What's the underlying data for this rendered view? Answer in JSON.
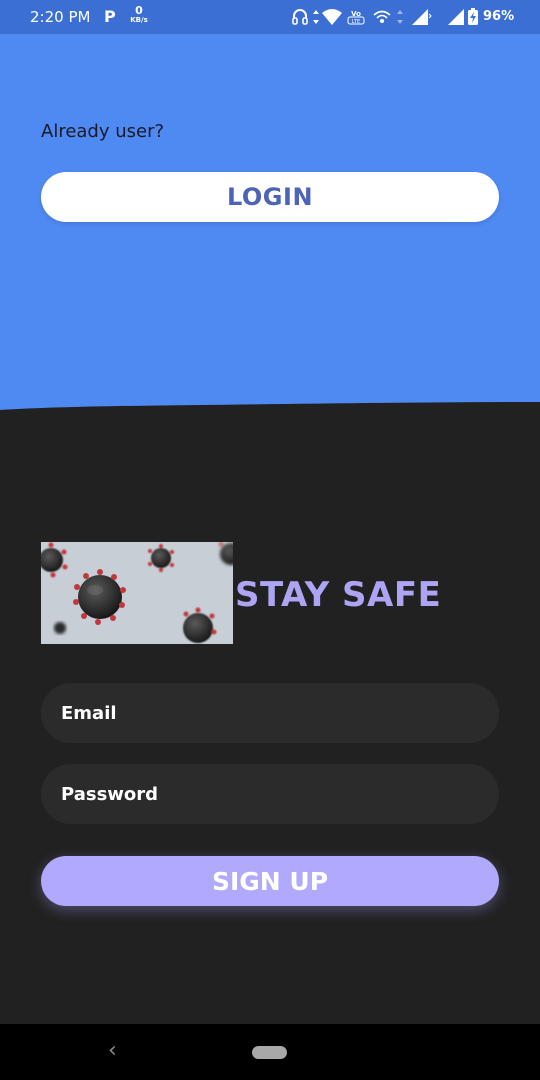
{
  "status_bar": {
    "time": "2:20 PM",
    "app_indicator": "P",
    "speed_value": "0",
    "speed_unit": "KB/s",
    "icons": [
      "headphones-icon",
      "data-arrows-icon",
      "wifi-icon",
      "volte-icon",
      "hotspot-icon",
      "signal-icon",
      "battery-charging-icon"
    ],
    "battery": "96%"
  },
  "top": {
    "background_color": "#4f89f2",
    "prompt": "Already user?",
    "login_label": "LOGIN"
  },
  "banner": {
    "image": "coronavirus-illustration",
    "title": "STAY SAFE"
  },
  "form": {
    "email_placeholder": "Email",
    "password_placeholder": "Password",
    "signup_label": "SIGN UP"
  },
  "nav": {
    "back": "‹"
  },
  "colors": {
    "accent_blue": "#4f89f2",
    "dark_bg": "#212121",
    "field_bg": "#2b2b2b",
    "signup_purple": "#b1aafc",
    "title_purple": "#ada5f4"
  }
}
